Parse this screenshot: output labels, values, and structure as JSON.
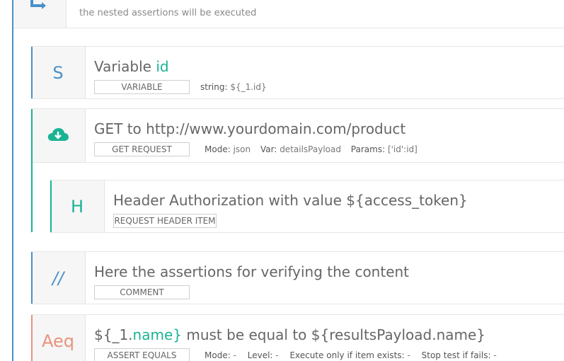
{
  "top_block": {
    "subtitle": "the nested assertions will be executed",
    "icon": "loop-arrows-icon"
  },
  "variable_block": {
    "icon_letter": "S",
    "title_prefix": "Variable ",
    "title_var": "id",
    "tag": "VARIABLE",
    "meta_string_label": "string:",
    "meta_string_value": "${_1.id}"
  },
  "get_block": {
    "icon": "cloud-download-icon",
    "title": "GET to http://www.yourdomain.com/product",
    "tag": "GET REQUEST",
    "mode_label": "Mode:",
    "mode_value": "json",
    "var_label": "Var:",
    "var_value": "detailsPayload",
    "params_label": "Params:",
    "params_value": "['id':id]"
  },
  "header_block": {
    "icon_letter": "H",
    "title": "Header Authorization with value ${access_token}",
    "tag": "REQUEST HEADER ITEM"
  },
  "comment_block": {
    "icon_letter": "//",
    "title": "Here the assertions for verifying the content",
    "tag": "COMMENT"
  },
  "assert_block": {
    "icon_letter": "Aeq",
    "title_part1": "${_1.",
    "title_var": "name}",
    "title_part2": " must be equal to ${resultsPayload.name}",
    "tag": "ASSERT EQUALS",
    "mode_label": "Mode:",
    "mode_value": "-",
    "level_label": "Level:",
    "level_value": "-",
    "exists_label": "Execute only if item exists:",
    "exists_value": "-",
    "stop_label": "Stop test if fails:",
    "stop_value": "-"
  },
  "colors": {
    "blue_accent": "#4a90c9",
    "green_accent": "#1ab394",
    "salmon_accent": "#e8927c"
  }
}
